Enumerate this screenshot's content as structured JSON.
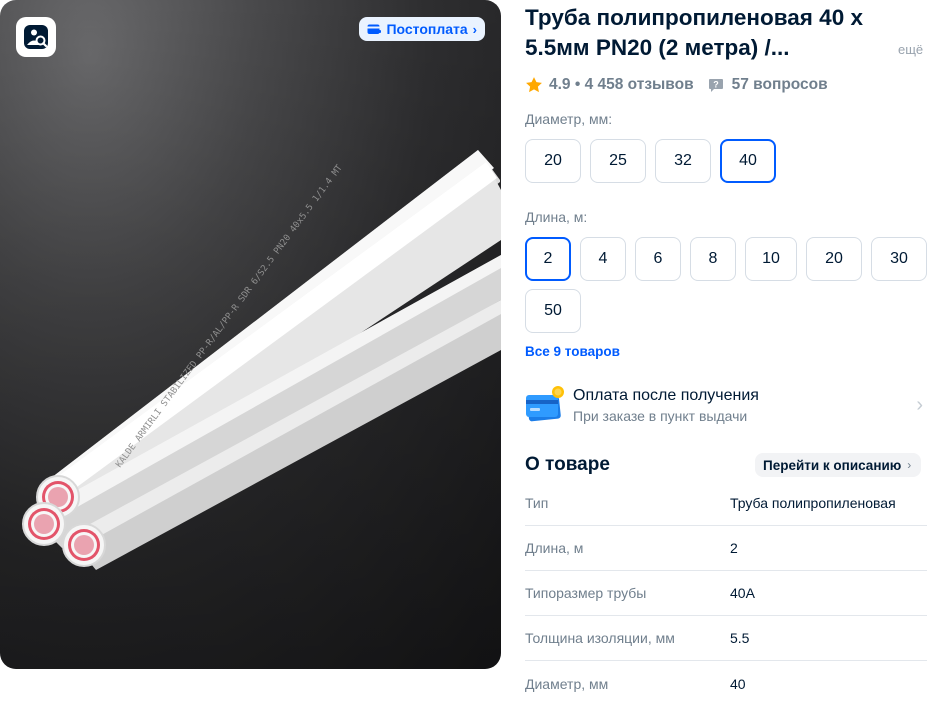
{
  "product": {
    "title": "Труба полипропиленовая 40 х 5.5мм PN20 (2 метра) /...",
    "more_label": "ещё"
  },
  "image": {
    "badge_label": "Постоплата",
    "zoom_icon": "image-search-icon",
    "pipe_print": "KALDE ARMIRLI STABILIZED PP-R/AL/PP-R SDR 6/S2.5 PN20 40x5.5 1/1.4 MT"
  },
  "rating": {
    "text": "4.9 • 4 458 отзывов",
    "questions": "57 вопросов",
    "star_color": "#ffa800"
  },
  "diameter": {
    "label": "Диаметр, мм:",
    "options": [
      "20",
      "25",
      "32",
      "40"
    ],
    "selected": "40"
  },
  "length": {
    "label": "Длина, м:",
    "options": [
      "2",
      "4",
      "6",
      "8",
      "10",
      "20",
      "30",
      "50"
    ],
    "selected": "2"
  },
  "all_products_link": "Все 9 товаров",
  "payment": {
    "title": "Оплата после получения",
    "subtitle": "При заказе в пункт выдачи"
  },
  "about": {
    "title": "О товаре",
    "goto_label": "Перейти к описанию",
    "specs": [
      {
        "key": "Тип",
        "value": "Труба полипропиленовая"
      },
      {
        "key": "Длина, м",
        "value": "2"
      },
      {
        "key": "Типоразмер трубы",
        "value": "40А"
      },
      {
        "key": "Толщина изоляции, мм",
        "value": "5.5"
      },
      {
        "key": "Диаметр, мм",
        "value": "40"
      }
    ]
  },
  "colors": {
    "accent": "#005bff",
    "text": "#001a34",
    "muted": "#707f8d"
  }
}
